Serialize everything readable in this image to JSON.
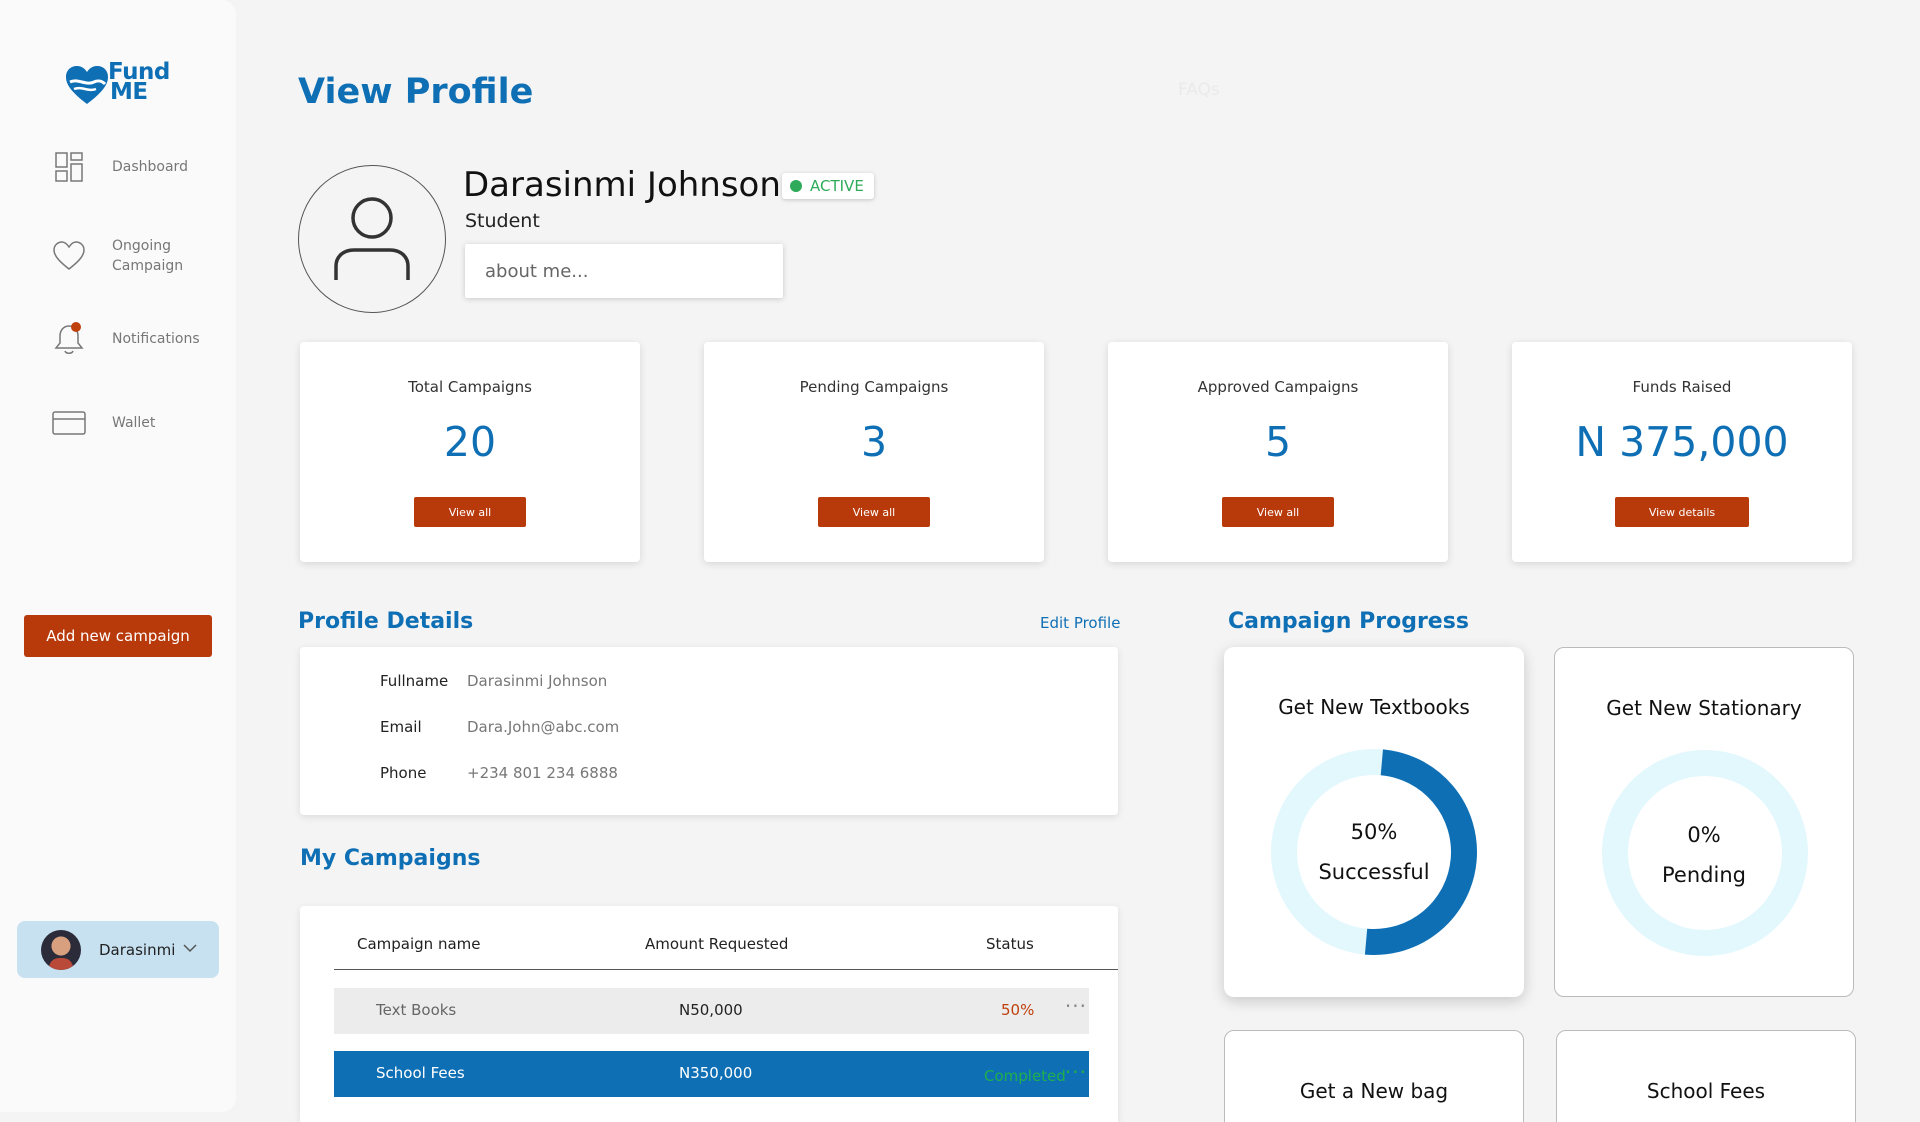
{
  "brand": {
    "line1": "Fund",
    "line2": "ME",
    "color": "#0f6fb5"
  },
  "sidebar": {
    "items": [
      {
        "label": "Dashboard",
        "icon": "dashboard-grid-icon"
      },
      {
        "label": "Ongoing\nCampaign",
        "icon": "heart-icon"
      },
      {
        "label": "Notifications",
        "icon": "bell-icon"
      },
      {
        "label": "Wallet",
        "icon": "wallet-card-icon"
      }
    ],
    "add_button": "Add new campaign",
    "user": {
      "name": "Darasinmi"
    }
  },
  "header": {
    "title": "View Profile",
    "faqs": "FAQs"
  },
  "profile": {
    "name": "Darasinmi Johnson",
    "status": "ACTIVE",
    "role": "Student",
    "about_placeholder": "about me..."
  },
  "stats": [
    {
      "label": "Total Campaigns",
      "value": "20",
      "button": "View all"
    },
    {
      "label": "Pending Campaigns",
      "value": "3",
      "button": "View all"
    },
    {
      "label": "Approved Campaigns",
      "value": "5",
      "button": "View all"
    },
    {
      "label": "Funds Raised",
      "value": "N 375,000",
      "button": "View details"
    }
  ],
  "details": {
    "title": "Profile Details",
    "edit": "Edit Profile",
    "rows": [
      {
        "key": "Fullname",
        "value": "Darasinmi Johnson"
      },
      {
        "key": "Email",
        "value": "Dara.John@abc.com"
      },
      {
        "key": "Phone",
        "value": "+234 801 234 6888"
      }
    ]
  },
  "campaigns": {
    "title": "My Campaigns",
    "headers": [
      "Campaign name",
      "Amount Requested",
      "Status"
    ],
    "rows": [
      {
        "name": "Text Books",
        "amount": "N50,000",
        "status": "50%"
      },
      {
        "name": "School Fees",
        "amount": "N350,000",
        "status": "Completed"
      }
    ]
  },
  "progress": {
    "title": "Campaign Progress",
    "cards": [
      {
        "title": "Get New Textbooks",
        "percent_label": "50%",
        "state": "Successful",
        "progress": 0.5
      },
      {
        "title": "Get New Stationary",
        "percent_label": "0%",
        "state": "Pending",
        "progress": 0
      },
      {
        "title": "Get a New bag"
      },
      {
        "title": "School Fees"
      }
    ]
  },
  "colors": {
    "primary": "#0f6fb5",
    "accent": "#b83a0b",
    "active_green": "#2eaa5a",
    "ring_track": "#e3f8fd",
    "completed_green": "#1fb04c"
  }
}
